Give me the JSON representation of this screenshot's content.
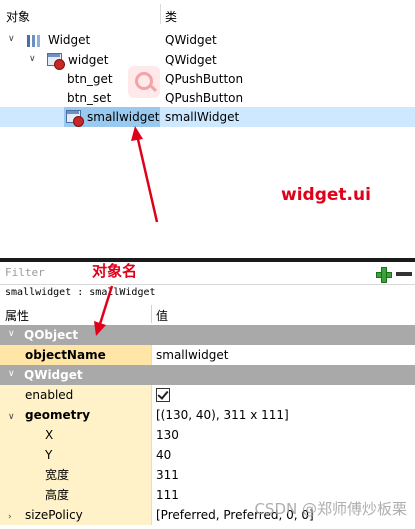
{
  "object_inspector": {
    "col_object": "对象",
    "col_class": "类",
    "rows": [
      {
        "name": "Widget",
        "cls": "QWidget"
      },
      {
        "name": "widget",
        "cls": "QWidget"
      },
      {
        "name": "btn_get",
        "cls": "QPushButton"
      },
      {
        "name": "btn_set",
        "cls": "QPushButton"
      },
      {
        "name": "smallwidget",
        "cls": "smallWidget"
      }
    ],
    "selected": "smallwidget"
  },
  "annotations": {
    "file_label": "widget.ui",
    "object_name_label": "对象名",
    "color": "#e0001a"
  },
  "filter": {
    "placeholder": "Filter"
  },
  "current_object": "smallwidget : smallWidget",
  "property_editor": {
    "col_property": "属性",
    "col_value": "值",
    "groups": [
      {
        "name": "QObject"
      },
      {
        "name": "QWidget"
      }
    ],
    "props": [
      {
        "name": "objectName",
        "value": "smallwidget"
      },
      {
        "name": "enabled",
        "value": "checked"
      },
      {
        "name": "geometry",
        "value": "[(130, 40), 311 x 111]"
      },
      {
        "name": "X",
        "value": "130"
      },
      {
        "name": "Y",
        "value": "40"
      },
      {
        "name": "宽度",
        "value": "311"
      },
      {
        "name": "高度",
        "value": "111"
      },
      {
        "name": "sizePolicy",
        "value": "[Preferred, Preferred, 0, 0]"
      }
    ]
  },
  "watermark": "CSDN @郑师傅炒板栗",
  "colors": {
    "selection": "#cde8ff",
    "group_header": "#a9a9a9",
    "property_highlight": "#fff2c8"
  }
}
